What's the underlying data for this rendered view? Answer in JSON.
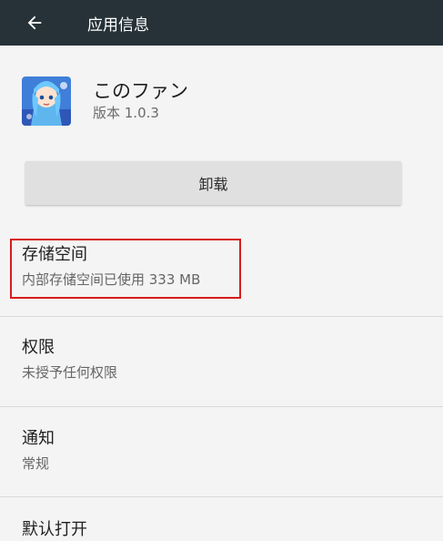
{
  "topbar": {
    "back_icon": "arrow-left-icon",
    "title": "应用信息"
  },
  "app": {
    "icon": "app-icon-anime-character",
    "name": "このファン",
    "version": "版本 1.0.3"
  },
  "actions": {
    "uninstall_label": "卸载"
  },
  "settings": [
    {
      "title": "存储空间",
      "subtitle": "内部存储空间已使用 333 MB"
    },
    {
      "title": "权限",
      "subtitle": "未授予任何权限"
    },
    {
      "title": "通知",
      "subtitle": "常规"
    },
    {
      "title": "默认打开",
      "subtitle": ""
    }
  ],
  "colors": {
    "topbar_bg": "#263238",
    "page_bg": "#f4f4f4",
    "button_bg": "#e0e0e0",
    "highlight": "#d81c1c"
  }
}
